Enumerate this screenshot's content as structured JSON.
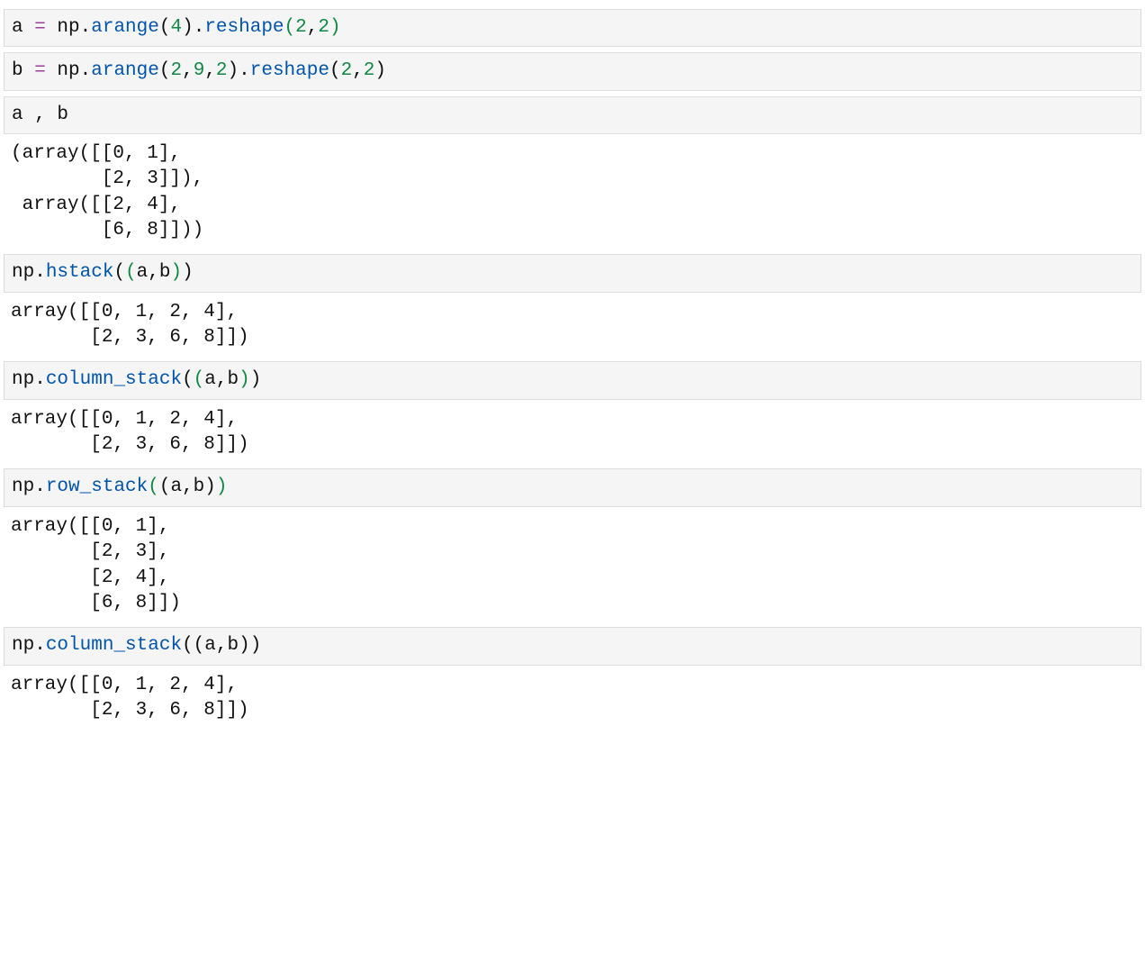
{
  "cells": [
    {
      "kind": "in",
      "tokens": [
        {
          "t": "a ",
          "c": "par"
        },
        {
          "t": "=",
          "c": "kw"
        },
        {
          "t": " np",
          "c": "par"
        },
        {
          "t": ".",
          "c": "par"
        },
        {
          "t": "arange",
          "c": "fn"
        },
        {
          "t": "(",
          "c": "par"
        },
        {
          "t": "4",
          "c": "num"
        },
        {
          "t": ")",
          "c": "par"
        },
        {
          "t": ".",
          "c": "par"
        },
        {
          "t": "reshape",
          "c": "fn"
        },
        {
          "t": "(",
          "c": "pg"
        },
        {
          "t": "2",
          "c": "num"
        },
        {
          "t": ",",
          "c": "par"
        },
        {
          "t": "2",
          "c": "num"
        },
        {
          "t": ")",
          "c": "pg"
        }
      ]
    },
    {
      "kind": "in",
      "tokens": [
        {
          "t": "b ",
          "c": "par"
        },
        {
          "t": "=",
          "c": "kw"
        },
        {
          "t": " np",
          "c": "par"
        },
        {
          "t": ".",
          "c": "par"
        },
        {
          "t": "arange",
          "c": "fn"
        },
        {
          "t": "(",
          "c": "par"
        },
        {
          "t": "2",
          "c": "num"
        },
        {
          "t": ",",
          "c": "par"
        },
        {
          "t": "9",
          "c": "num"
        },
        {
          "t": ",",
          "c": "par"
        },
        {
          "t": "2",
          "c": "num"
        },
        {
          "t": ")",
          "c": "par"
        },
        {
          "t": ".",
          "c": "par"
        },
        {
          "t": "reshape",
          "c": "fn"
        },
        {
          "t": "(",
          "c": "par"
        },
        {
          "t": "2",
          "c": "num"
        },
        {
          "t": ",",
          "c": "par"
        },
        {
          "t": "2",
          "c": "num"
        },
        {
          "t": ")",
          "c": "par"
        }
      ]
    },
    {
      "kind": "in",
      "tokens": [
        {
          "t": "a , b",
          "c": "par"
        }
      ]
    },
    {
      "kind": "out",
      "text": "(array([[0, 1],\n        [2, 3]]),\n array([[2, 4],\n        [6, 8]]))"
    },
    {
      "kind": "in",
      "tokens": [
        {
          "t": "np",
          "c": "par"
        },
        {
          "t": ".",
          "c": "par"
        },
        {
          "t": "hstack",
          "c": "fn"
        },
        {
          "t": "(",
          "c": "par"
        },
        {
          "t": "(",
          "c": "pg"
        },
        {
          "t": "a,b",
          "c": "par"
        },
        {
          "t": ")",
          "c": "pg"
        },
        {
          "t": ")",
          "c": "par"
        }
      ]
    },
    {
      "kind": "out",
      "text": "array([[0, 1, 2, 4],\n       [2, 3, 6, 8]])"
    },
    {
      "kind": "in",
      "tokens": [
        {
          "t": "np",
          "c": "par"
        },
        {
          "t": ".",
          "c": "par"
        },
        {
          "t": "column_stack",
          "c": "fn"
        },
        {
          "t": "(",
          "c": "par"
        },
        {
          "t": "(",
          "c": "pg"
        },
        {
          "t": "a,b",
          "c": "par"
        },
        {
          "t": ")",
          "c": "pg"
        },
        {
          "t": ")",
          "c": "par"
        }
      ]
    },
    {
      "kind": "out",
      "text": "array([[0, 1, 2, 4],\n       [2, 3, 6, 8]])"
    },
    {
      "kind": "in",
      "tokens": [
        {
          "t": "np",
          "c": "par"
        },
        {
          "t": ".",
          "c": "par"
        },
        {
          "t": "row_stack",
          "c": "fn"
        },
        {
          "t": "(",
          "c": "pg"
        },
        {
          "t": "(",
          "c": "par"
        },
        {
          "t": "a,b",
          "c": "par"
        },
        {
          "t": ")",
          "c": "par"
        },
        {
          "t": ")",
          "c": "pg"
        }
      ]
    },
    {
      "kind": "out",
      "text": "array([[0, 1],\n       [2, 3],\n       [2, 4],\n       [6, 8]])"
    },
    {
      "kind": "in",
      "tokens": [
        {
          "t": "np",
          "c": "par"
        },
        {
          "t": ".",
          "c": "par"
        },
        {
          "t": "column_stack",
          "c": "fn"
        },
        {
          "t": "(",
          "c": "par"
        },
        {
          "t": "(a,b)",
          "c": "par"
        },
        {
          "t": ")",
          "c": "par"
        }
      ]
    },
    {
      "kind": "out",
      "text": "array([[0, 1, 2, 4],\n       [2, 3, 6, 8]])"
    }
  ]
}
